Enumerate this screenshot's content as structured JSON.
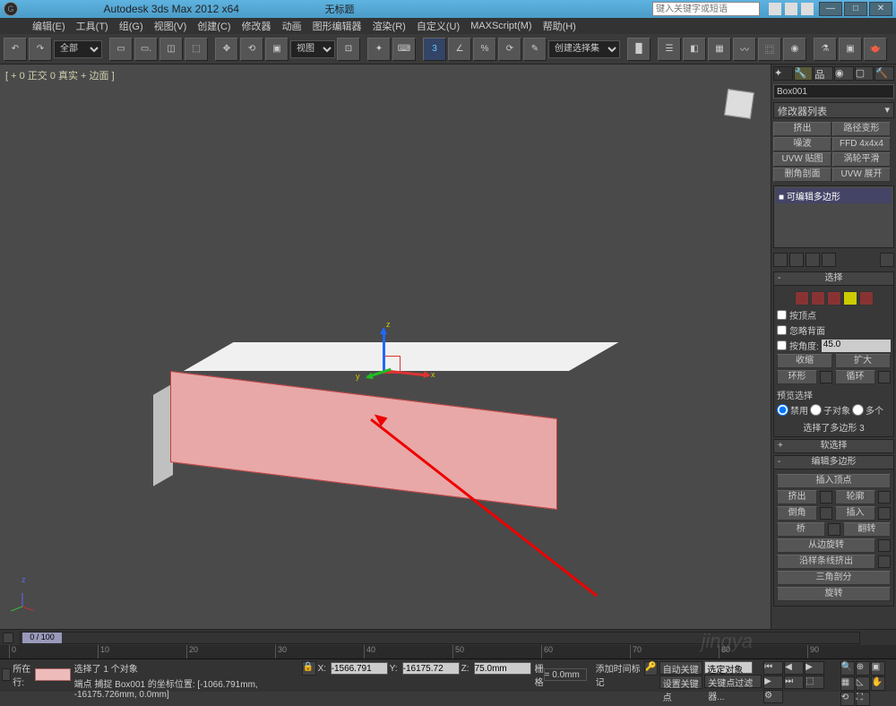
{
  "title": "Autodesk 3ds Max  2012  x64",
  "untitled": "无标题",
  "search_placeholder": "键入关键字或短语",
  "winbtns": {
    "min": "—",
    "max": "□",
    "close": "✕"
  },
  "menu": [
    "编辑(E)",
    "工具(T)",
    "组(G)",
    "视图(V)",
    "创建(C)",
    "修改器",
    "动画",
    "图形编辑器",
    "渲染(R)",
    "自定义(U)",
    "MAXScript(M)",
    "帮助(H)"
  ],
  "toolbar": {
    "selset": "全部",
    "views": "视图",
    "create_sel": "创建选择集",
    "spin": "3"
  },
  "viewport_label": "[ + 0 正交 0 真实 + 边面 ]",
  "gizmo_labels": {
    "x": "x",
    "y": "y",
    "z": "z"
  },
  "cmd": {
    "obj_name": "Box001",
    "modlist": "修改器列表",
    "modbtns": [
      "挤出",
      "路径变形",
      "噪波",
      "FFD 4x4x4",
      "UVW 贴图",
      "涡轮平滑",
      "删角剖面",
      "UVW 展开"
    ],
    "stack_item": "可编辑多边形",
    "roll_select": "选择",
    "by_vertex": "按顶点",
    "ignore_back": "忽略背面",
    "by_angle": "按角度:",
    "angle_val": "45.0",
    "shrink": "收缩",
    "grow": "扩大",
    "ring": "环形",
    "loop": "循环",
    "preview": "预览选择",
    "pv_off": "禁用",
    "pv_sub": "子对象",
    "pv_multi": "多个",
    "selected": "选择了多边形 3",
    "roll_soft": "软选择",
    "roll_editpoly": "编辑多边形",
    "insert_vert": "插入顶点",
    "extrude": "挤出",
    "outline": "轮廓",
    "bevel": "倒角",
    "inset": "插入",
    "bridge": "桥",
    "flip": "翻转",
    "hinge": "从边旋转",
    "ex_spline": "沿样条线挤出",
    "tri": "三角剖分",
    "retri": "旋转"
  },
  "timeline": {
    "handle": "0 / 100",
    "ticks": [
      "0",
      "10",
      "20",
      "30",
      "40",
      "50",
      "60",
      "70",
      "80",
      "90"
    ]
  },
  "status": {
    "prompt_label": "所在行:",
    "info1": "选择了 1 个对象",
    "info2": "端点 捕捉 Box001 的坐标位置: [-1066.791mm, -16175.726mm, 0.0mm]",
    "x": "-1566.791",
    "y": "-16175.72",
    "z": "75.0mm",
    "grid_lbl": "栅格",
    "grid_val": "= 0.0mm",
    "autokey": "自动关键点",
    "setkey": "设置关键点",
    "sel_filter": "选定对象",
    "key_filter": "关键点过滤器...",
    "add_tag": "添加时间标记"
  },
  "watermark": "jingya"
}
